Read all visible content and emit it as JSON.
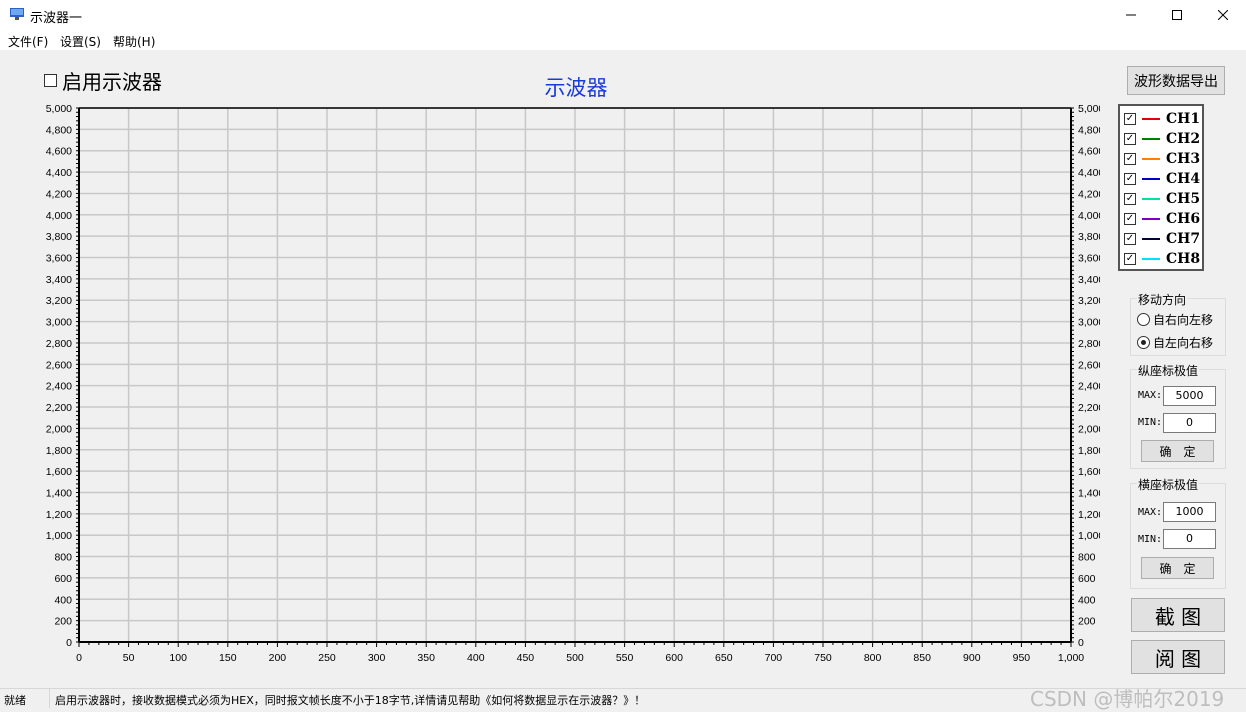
{
  "window": {
    "title": "示波器一"
  },
  "menu": [
    "文件(F)",
    "设置(S)",
    "帮助(H)"
  ],
  "enable_label": "启用示波器",
  "export_label": "波形数据导出",
  "chart_data": {
    "type": "line",
    "title": "示波器",
    "xlim": [
      0,
      1000
    ],
    "ylim": [
      0,
      5000
    ],
    "x_ticks": [
      "0",
      "50",
      "100",
      "150",
      "200",
      "250",
      "300",
      "350",
      "400",
      "450",
      "500",
      "550",
      "600",
      "650",
      "700",
      "750",
      "800",
      "850",
      "900",
      "950",
      "1,000"
    ],
    "y_ticks": [
      "0",
      "200",
      "400",
      "600",
      "800",
      "1,000",
      "1,200",
      "1,400",
      "1,600",
      "1,800",
      "2,000",
      "2,200",
      "2,400",
      "2,600",
      "2,800",
      "3,000",
      "3,200",
      "3,400",
      "3,600",
      "3,800",
      "4,000",
      "4,200",
      "4,400",
      "4,600",
      "4,800",
      "5,000"
    ],
    "grid": true,
    "series": []
  },
  "legend": [
    {
      "label": "CH1",
      "color": "#e00000",
      "checked": true
    },
    {
      "label": "CH2",
      "color": "#008000",
      "checked": true
    },
    {
      "label": "CH3",
      "color": "#ff8000",
      "checked": true
    },
    {
      "label": "CH4",
      "color": "#0000c0",
      "checked": true
    },
    {
      "label": "CH5",
      "color": "#00e0a0",
      "checked": true
    },
    {
      "label": "CH6",
      "color": "#8000c0",
      "checked": true
    },
    {
      "label": "CH7",
      "color": "#000040",
      "checked": true
    },
    {
      "label": "CH8",
      "color": "#00e0ff",
      "checked": true
    }
  ],
  "move": {
    "title": "移动方向",
    "options": [
      "自右向左移",
      "自左向右移"
    ],
    "selected": 1
  },
  "yrange": {
    "title": "纵座标极值",
    "max_label": "MAX:",
    "max": "5000",
    "min_label": "MIN:",
    "min": "0",
    "ok": "确　定"
  },
  "xrange": {
    "title": "横座标极值",
    "max_label": "MAX:",
    "max": "1000",
    "min_label": "MIN:",
    "min": "0",
    "ok": "确　定"
  },
  "screenshot_label": "截 图",
  "view_label": "阅 图",
  "status": {
    "ready": "就绪",
    "message": "启用示波器时，接收数据模式必须为HEX，同时报文帧长度不小于18字节,详情请见帮助《如何将数据显示在示波器？》！"
  },
  "watermark": "CSDN @博帕尔2019"
}
